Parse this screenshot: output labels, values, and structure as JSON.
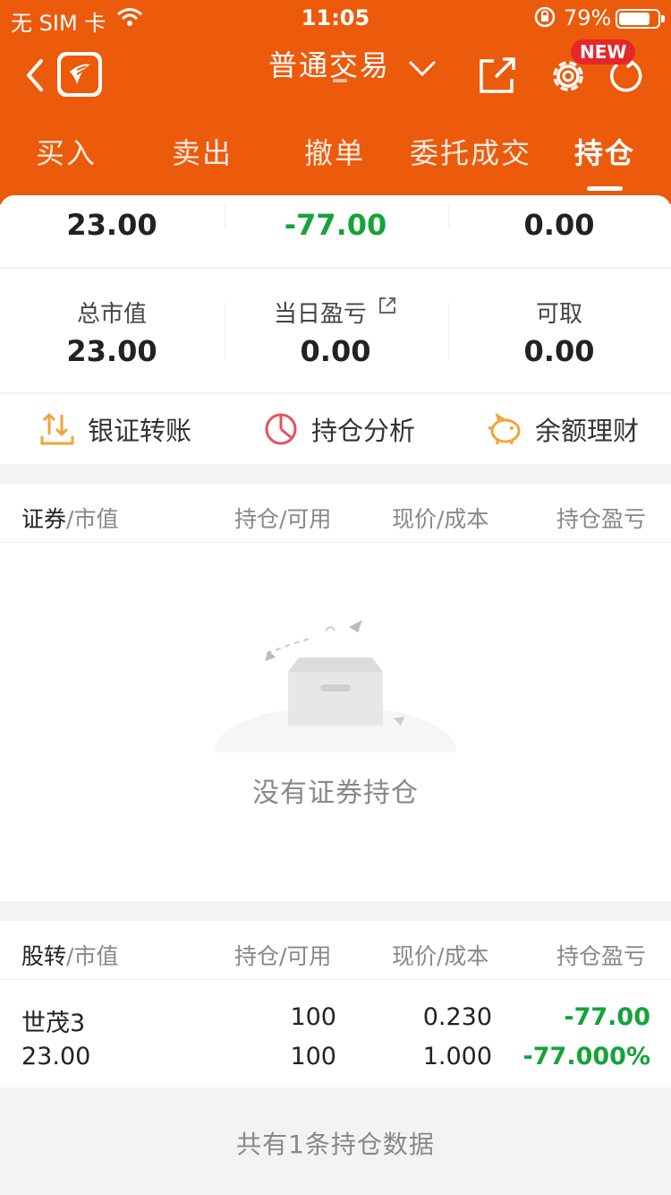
{
  "status_bar": {
    "carrier": "无 SIM 卡",
    "time": "11:05",
    "battery": "79%"
  },
  "nav": {
    "title": "普通交易",
    "new_badge": "NEW"
  },
  "tabs": [
    {
      "label": "买入"
    },
    {
      "label": "卖出"
    },
    {
      "label": "撤单"
    },
    {
      "label": "委托成交"
    },
    {
      "label": "持仓"
    }
  ],
  "summary": {
    "top_values": [
      "23.00",
      "-77.00",
      "0.00"
    ],
    "items": [
      {
        "label": "总市值",
        "value": "23.00"
      },
      {
        "label": "当日盈亏",
        "value": "0.00"
      },
      {
        "label": "可取",
        "value": "0.00"
      }
    ]
  },
  "actions": [
    {
      "label": "银证转账",
      "icon": "transfer-icon"
    },
    {
      "label": "持仓分析",
      "icon": "pie-chart-icon"
    },
    {
      "label": "余额理财",
      "icon": "piggy-bank-icon"
    }
  ],
  "securities_table": {
    "col1_main": "证券",
    "col1_sub": "/市值",
    "col2": "持仓/可用",
    "col3": "现价/成本",
    "col4": "持仓盈亏",
    "empty_text": "没有证券持仓"
  },
  "transfer_table": {
    "col1_main": "股转",
    "col1_sub": "/市值",
    "col2": "持仓/可用",
    "col3": "现价/成本",
    "col4": "持仓盈亏",
    "rows": [
      {
        "name": "世茂3",
        "market_value": "23.00",
        "position": "100",
        "available": "100",
        "price": "0.230",
        "cost": "1.000",
        "pl": "-77.00",
        "pl_pct": "-77.000%"
      }
    ]
  },
  "footer": {
    "text": "共有1条持仓数据"
  },
  "colors": {
    "brand": "#ec5a0c",
    "loss": "#16a33a",
    "badge": "#e7262a"
  }
}
